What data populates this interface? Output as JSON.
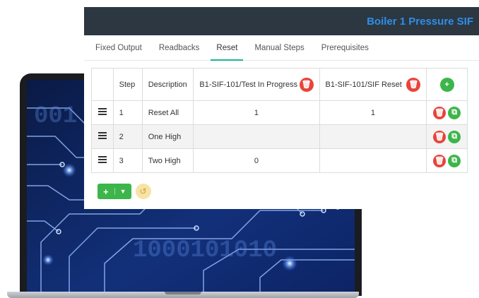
{
  "app": {
    "title": "Boiler 1 Pressure SIF"
  },
  "tabs": [
    {
      "label": "Fixed Output"
    },
    {
      "label": "Readbacks"
    },
    {
      "label": "Reset",
      "active": true
    },
    {
      "label": "Manual Steps"
    },
    {
      "label": "Prerequisites"
    }
  ],
  "table": {
    "headers": {
      "step": "Step",
      "description": "Description",
      "col1": "B1-SIF-101/Test In Progress",
      "col2": "B1-SIF-101/SIF Reset"
    },
    "rows": [
      {
        "step": "1",
        "description": "Reset All",
        "col1": "1",
        "col2": "1"
      },
      {
        "step": "2",
        "description": "One High",
        "col1": "",
        "col2": ""
      },
      {
        "step": "3",
        "description": "Two High",
        "col1": "0",
        "col2": ""
      }
    ]
  },
  "icons": {
    "header_add": "plus-icon",
    "header_delete": "trash-icon",
    "row_delete": "trash-icon",
    "row_copy": "copy-icon",
    "add": "plus-icon",
    "dropdown": "chevron-down-icon",
    "undo": "undo-icon"
  },
  "colors": {
    "header_bg": "#2c3742",
    "title": "#2e8fe6",
    "active_tab": "#1ab394",
    "danger": "#e8443a",
    "success": "#3cb54a",
    "undo": "#f8e3a6"
  }
}
